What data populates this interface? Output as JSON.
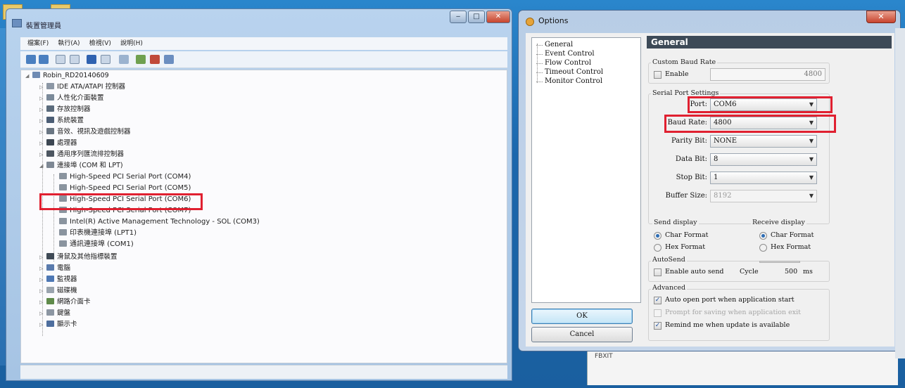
{
  "device_manager": {
    "title": "裝置管理員",
    "menu": [
      "檔案(F)",
      "執行(A)",
      "檢視(V)",
      "說明(H)"
    ],
    "tree": {
      "root": "Robin_RD20140609",
      "categories_top": [
        "IDE ATA/ATAPI 控制器",
        "人性化介面裝置",
        "存放控制器",
        "系統裝置",
        "音效、視訊及遊戲控制器",
        "處理器",
        "通用序列匯流排控制器"
      ],
      "ports_category": "連接埠 (COM 和 LPT)",
      "ports": [
        "High-Speed PCI Serial Port (COM4)",
        "High-Speed PCI Serial Port (COM5)",
        "High-Speed PCI Serial Port (COM6)",
        "High-Speed PCI Serial Port (COM7)",
        "Intel(R) Active Management Technology - SOL (COM3)",
        "印表機連接埠 (LPT1)",
        "通訊連接埠 (COM1)"
      ],
      "categories_bottom": [
        "滑鼠及其他指標裝置",
        "電腦",
        "監視器",
        "磁碟機",
        "網路介面卡",
        "鍵盤",
        "顯示卡"
      ]
    }
  },
  "options": {
    "title": "Options",
    "nav": [
      "General",
      "Event Control",
      "Flow Control",
      "Timeout Control",
      "Monitor Control"
    ],
    "ok_label": "OK",
    "cancel_label": "Cancel",
    "header": "General",
    "custom_baud": {
      "group": "Custom Baud Rate",
      "enable_label": "Enable",
      "value": "4800"
    },
    "serial": {
      "group": "Serial Port Settings",
      "port_label": "Port:",
      "port_value": "COM6",
      "baud_label": "Baud Rate:",
      "baud_value": "4800",
      "parity_label": "Parity Bit:",
      "parity_value": "NONE",
      "data_label": "Data Bit:",
      "data_value": "8",
      "stop_label": "Stop Bit:",
      "stop_value": "1",
      "buffer_label": "Buffer Size:",
      "buffer_value": "8192"
    },
    "send_display": {
      "group": "Send display",
      "char": "Char Format",
      "hex": "Hex Format"
    },
    "receive_display": {
      "group": "Receive display",
      "char": "Char Format",
      "hex": "Hex Format"
    },
    "autosend": {
      "group": "AutoSend",
      "enable_label": "Enable auto send",
      "cycle_label": "Cycle",
      "cycle_value": "500",
      "unit": "ms"
    },
    "advanced": {
      "group": "Advanced",
      "auto_open": "Auto open port when application start",
      "prompt_save": "Prompt for saving when application exit",
      "remind_update": "Remind me when update is available"
    }
  },
  "behind_text": "FBXIT",
  "colors": {
    "highlight": "#e02030",
    "header_bg": "#3d4a57",
    "desktop": "#1d6fb3"
  }
}
